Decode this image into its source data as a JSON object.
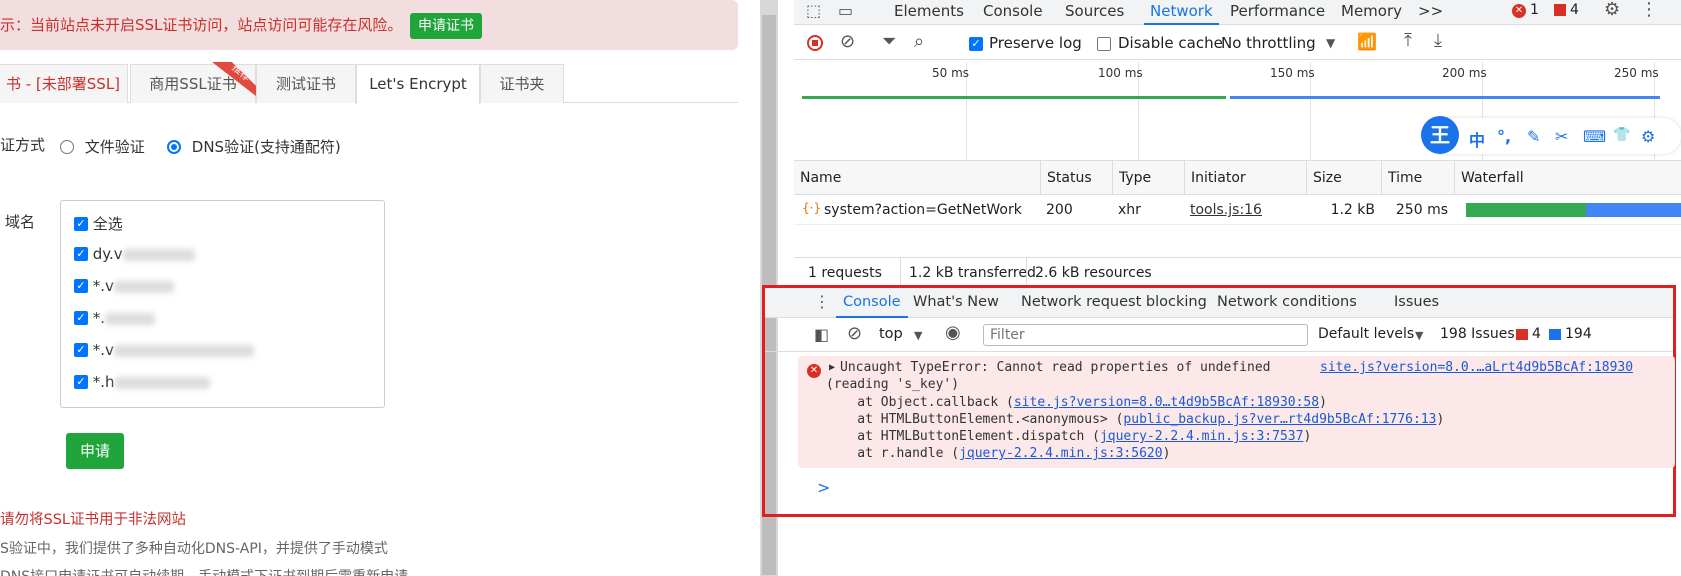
{
  "left": {
    "warning_text": "示：当前站点未开启SSL证书访问，站点访问可能存在风险。",
    "warning_button": "申请证书",
    "tabs": [
      "书 - [未部署SSL]",
      "商用SSL证书",
      "测试证书",
      "Let's Encrypt",
      "证书夹"
    ],
    "ribbon": "推荐",
    "verify_label": "证方式",
    "verify_options": [
      "文件验证",
      "DNS验证(支持通配符)"
    ],
    "domain_label": "域名",
    "domains": [
      "全选",
      "dy.v",
      "*.v",
      "*.",
      "*.v",
      "*.h"
    ],
    "apply_button": "申请",
    "notice_red": "请勿将SSL证书用于非法网站",
    "notice_1": "S验证中，我们提供了多种自动化DNS-API，并提供了手动模式",
    "notice_2": "DNS接口申请证书可自动续期，手动模式下证书到期后需重新申请"
  },
  "devtools": {
    "top_tabs": [
      "Elements",
      "Console",
      "Sources",
      "Network",
      "Performance",
      "Memory"
    ],
    "more": ">>",
    "error_count": "1",
    "issue_count": "4",
    "preserve_log": "Preserve log",
    "disable_cache": "Disable cache",
    "throttling": "No throttling",
    "ticks": [
      "50 ms",
      "100 ms",
      "150 ms",
      "200 ms",
      "250 ms"
    ],
    "columns": [
      "Name",
      "Status",
      "Type",
      "Initiator",
      "Size",
      "Time",
      "Waterfall"
    ],
    "request": {
      "name": "system?action=GetNetWork",
      "status": "200",
      "type": "xhr",
      "initiator": "tools.js:16",
      "size": "1.2 kB",
      "time": "250 ms"
    },
    "summary": [
      "1 requests",
      "1.2 kB transferred",
      "2.6 kB resources"
    ],
    "drawer_tabs": [
      "Console",
      "What's New",
      "Network request blocking",
      "Network conditions",
      "Issues"
    ],
    "context": "top",
    "filter_placeholder": "Filter",
    "levels": "Default levels",
    "issues_label": "198 Issues:",
    "issues_err": "4",
    "issues_info": "194",
    "error": {
      "line1": "Uncaught TypeError: Cannot read properties of undefined",
      "source": "site.js?version=8.0.…aLrt4d9b5BcAf:18930",
      "line2": "(reading 's_key')",
      "stack": [
        {
          "prefix": "    at Object.callback (",
          "link": "site.js?version=8.0…t4d9b5BcAf:18930:58",
          "suffix": ")"
        },
        {
          "prefix": "    at HTMLButtonElement.<anonymous> (",
          "link": "public_backup.js?ver…rt4d9b5BcAf:1776:13",
          "suffix": ")"
        },
        {
          "prefix": "    at HTMLButtonElement.dispatch (",
          "link": "jquery-2.2.4.min.js:3:7537",
          "suffix": ")"
        },
        {
          "prefix": "    at r.handle (",
          "link": "jquery-2.2.4.min.js:3:5620",
          "suffix": ")"
        }
      ]
    },
    "prompt": ">",
    "ime": [
      "王",
      "中",
      "°,",
      "✎",
      "✂",
      "⌨",
      "👕",
      "⚙"
    ]
  }
}
